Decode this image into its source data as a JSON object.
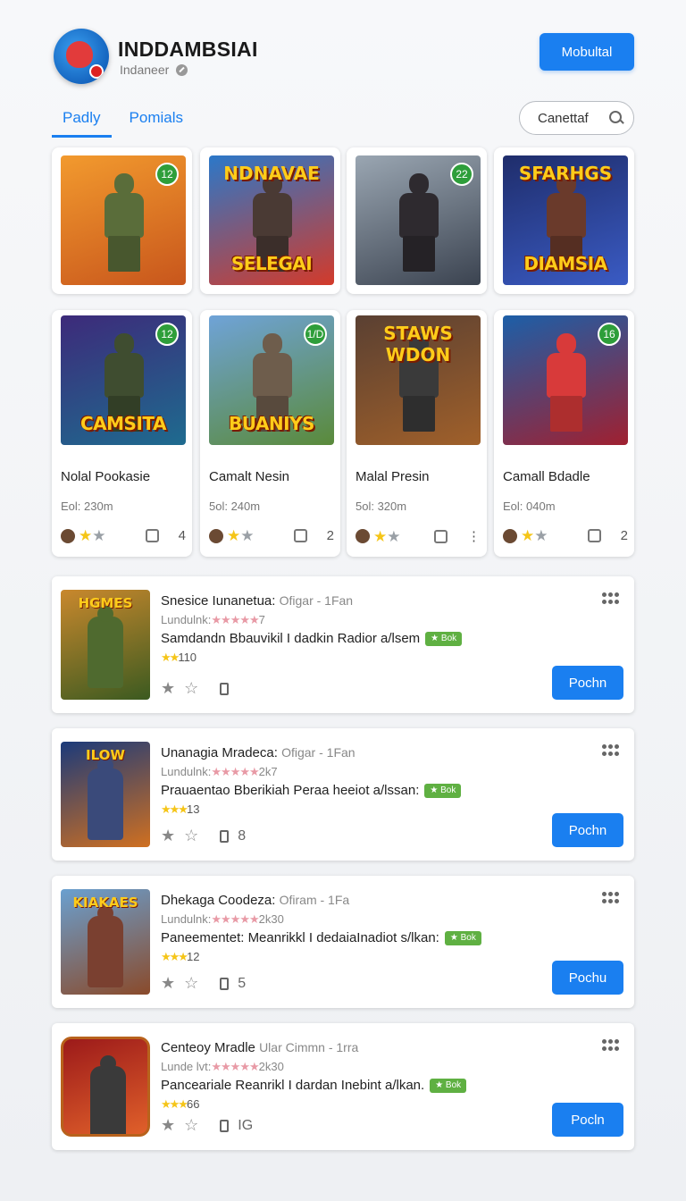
{
  "header": {
    "title": "INDDAMBSIAI",
    "subtitle": "Indaneer",
    "primary_button": "Mobultal"
  },
  "tabs": [
    {
      "label": "Padly",
      "active": true
    },
    {
      "label": "Pomials",
      "active": false
    }
  ],
  "search": {
    "label": "Canettaf"
  },
  "grid_row1": [
    {
      "badge": "12",
      "art_title": "",
      "art_top": "",
      "colors": [
        "#f29a2e",
        "#c8561c"
      ],
      "fig": "#5a6d3a"
    },
    {
      "badge": "",
      "art_title": "SELEGAI",
      "art_top": "NDNAVAE",
      "colors": [
        "#2b78c9",
        "#d33a2a"
      ],
      "fig": "#4a3a34"
    },
    {
      "badge": "22",
      "art_title": "",
      "art_top": "",
      "colors": [
        "#9aa6b2",
        "#3b4350"
      ],
      "fig": "#2e2a2f"
    },
    {
      "badge": "",
      "art_title": "DIAMSIA",
      "art_top": "SFARHGS",
      "colors": [
        "#1f2d6b",
        "#3a5bc4"
      ],
      "fig": "#6a3a2b"
    }
  ],
  "grid_row2": [
    {
      "badge": "12",
      "art_title": "CAMSITA",
      "art_top": "",
      "name": "Nolal Pookasie",
      "meta": "Eol: 230m",
      "count": "4",
      "colors": [
        "#3d2a7a",
        "#1e6b8f"
      ],
      "fig": "#3f4d30"
    },
    {
      "badge": "1/D",
      "art_title": "BUANIYS",
      "art_top": "",
      "name": "Camalt Nesin",
      "meta": "5ol: 240m",
      "count": "2",
      "colors": [
        "#6fa3d8",
        "#5a8a3a"
      ],
      "fig": "#6e5d4c"
    },
    {
      "badge": "",
      "art_title": "",
      "art_top": "STAWS WDON",
      "name": "Malal Presin",
      "meta": "5ol: 320m",
      "count": "⋮",
      "colors": [
        "#5a4032",
        "#a0602a"
      ],
      "fig": "#3a3a3a"
    },
    {
      "badge": "16",
      "art_title": "",
      "art_top": "",
      "name": "Camall Bdadle",
      "meta": "Eol: 040m",
      "count": "2",
      "colors": [
        "#1c5fa8",
        "#a02030"
      ],
      "fig": "#d83a3a"
    }
  ],
  "list": [
    {
      "title": "Snesice Iunanetua:",
      "title_muted": "Ofigar - 1Fan",
      "line2_prefix": "Lundulnk:",
      "line2_stars": "★★★★★",
      "line2_suffix": "7",
      "line3": "Samdandn Bbauvikil I dadkin Radior a/lsem",
      "tag": "★ Bok",
      "rating": "★★",
      "rating_count": "110",
      "action_count": "",
      "button": "Pochn",
      "colors": [
        "#c9882d",
        "#3b5a20"
      ],
      "fig": "#4f6a2f",
      "mini_title": "HGMES"
    },
    {
      "title": "Unanagia Mradeca:",
      "title_muted": "Ofigar - 1Fan",
      "line2_prefix": "Lundulnk:",
      "line2_stars": "★★★★★",
      "line2_suffix": "2k7",
      "line3": "Prauaentao Bberikiah Peraa heeiot a/lssan:",
      "tag": "★ Bok",
      "rating": "★★★",
      "rating_count": "13",
      "action_count": "8",
      "button": "Pochn",
      "colors": [
        "#1b3a7a",
        "#d07020"
      ],
      "fig": "#3a4a7a",
      "mini_title": "ILOW"
    },
    {
      "title": "Dhekaga Coodeza:",
      "title_muted": "Ofiram - 1Fa",
      "line2_prefix": "Lundulnk:",
      "line2_stars": "★★★★★",
      "line2_suffix": "2k30",
      "line3": "Paneementet: Meanrikkl I dedaiaInadiot s/lkan:",
      "tag": "★ Bok",
      "rating": "★★★",
      "rating_count": "12",
      "action_count": "5",
      "button": "Pochu",
      "colors": [
        "#6aa0d0",
        "#8a4a2a"
      ],
      "fig": "#7a4030",
      "mini_title": "KIAKAES"
    },
    {
      "title": "Centeoy Mradle",
      "title_muted": "Ular Cimmn - 1rra",
      "line2_prefix": "Lunde lvt:",
      "line2_stars": "★★★★★",
      "line2_suffix": "2k30",
      "line3": "Panceariale Reanrikl I dardan Inebint a/lkan.",
      "tag": "★ Bok",
      "rating": "★★★",
      "rating_count": "66",
      "action_count": "IG",
      "button": "Pocln",
      "colors": [
        "#9c1a1a",
        "#e0602a"
      ],
      "fig": "#3a3a3a",
      "mini_title": ""
    }
  ]
}
